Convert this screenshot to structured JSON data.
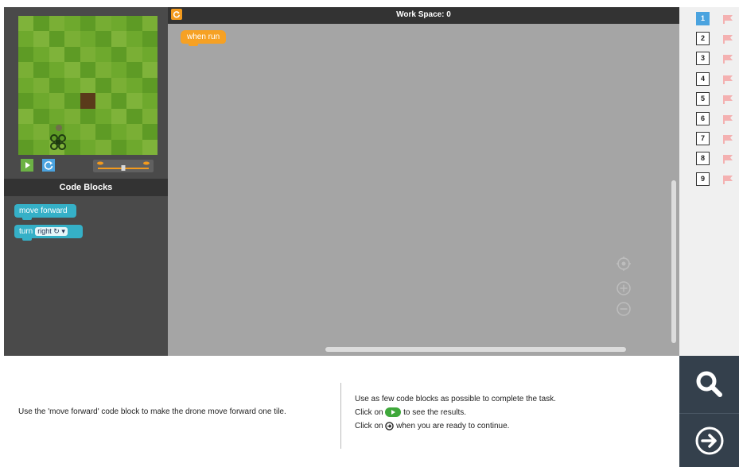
{
  "simulation": {
    "grid_colors": [
      [
        "#7fb33a",
        "#5e9b25",
        "#7aaf35",
        "#6ea92d",
        "#5e9b25",
        "#76ad33",
        "#6ea92d",
        "#5e9b25",
        "#7aaf35"
      ],
      [
        "#6ea92d",
        "#7fb33a",
        "#5e9b25",
        "#7aaf35",
        "#6ea92d",
        "#5e9b25",
        "#7fb33a",
        "#6ea92d",
        "#5e9b25"
      ],
      [
        "#5e9b25",
        "#6ea92d",
        "#7fb33a",
        "#5e9b25",
        "#7aaf35",
        "#6ea92d",
        "#5e9b25",
        "#7aaf35",
        "#6ea92d"
      ],
      [
        "#7aaf35",
        "#5e9b25",
        "#6ea92d",
        "#7fb33a",
        "#5e9b25",
        "#7aaf35",
        "#6ea92d",
        "#5e9b25",
        "#7fb33a"
      ],
      [
        "#6ea92d",
        "#7aaf35",
        "#5e9b25",
        "#6ea92d",
        "#7fb33a",
        "#5e9b25",
        "#7aaf35",
        "#6ea92d",
        "#5e9b25"
      ],
      [
        "#5e9b25",
        "#6ea92d",
        "#7aaf35",
        "#5e9b25",
        "#5a3a1a",
        "#7aaf35",
        "#5e9b25",
        "#7fb33a",
        "#6ea92d"
      ],
      [
        "#7fb33a",
        "#5e9b25",
        "#6ea92d",
        "#7aaf35",
        "#5e9b25",
        "#6ea92d",
        "#7fb33a",
        "#5e9b25",
        "#7aaf35"
      ],
      [
        "#6ea92d",
        "#7aaf35",
        "#5e9b25",
        "#6ea92d",
        "#7aaf35",
        "#5e9b25",
        "#6ea92d",
        "#7aaf35",
        "#5e9b25"
      ],
      [
        "#5e9b25",
        "#6ea92d",
        "#7fb33a",
        "#5e9b25",
        "#6ea92d",
        "#7aaf35",
        "#5e9b25",
        "#6ea92d",
        "#7fb33a"
      ]
    ],
    "speed_level": 0.5
  },
  "code_blocks": {
    "header": "Code Blocks",
    "move_forward": "move forward",
    "turn_label": "turn",
    "turn_value": "right ↻"
  },
  "workspace": {
    "title": "Work Space: 0",
    "when_run": "when run"
  },
  "levels": {
    "items": [
      "1",
      "2",
      "3",
      "4",
      "5",
      "6",
      "7",
      "8",
      "9"
    ],
    "active": "1",
    "flag_color": "#f4b1b1"
  },
  "instructions": {
    "main": "Use the 'move forward' code block to make the drone move forward one tile.",
    "tip1": "Use as few code blocks as possible to complete the task.",
    "tip2_prefix": "Click on",
    "tip2_suffix": "to see the results.",
    "tip3_prefix": "Click on",
    "tip3_suffix": "when you are ready to continue."
  },
  "colors": {
    "accent_blue": "#4aa3df",
    "run_green": "#6cb245",
    "block_teal": "#35b0c7",
    "event_orange": "#f6a124",
    "dark_panel": "#34404c"
  }
}
